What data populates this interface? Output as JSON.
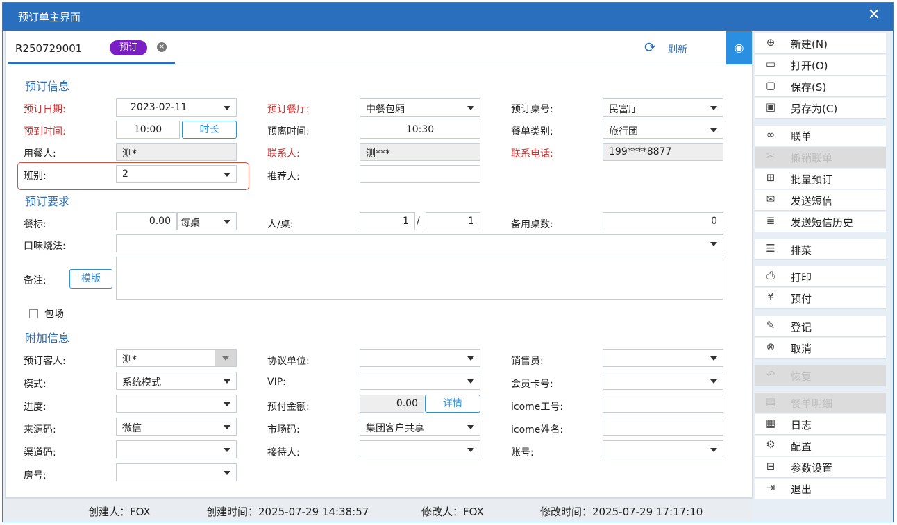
{
  "window": {
    "title": "预订单主界面",
    "close": "✕"
  },
  "tab": {
    "order_no": "R250729001",
    "badge": "预订",
    "close": "×"
  },
  "toolbar": {
    "refresh": "刷新",
    "refresh_icon": "⟳",
    "eye_icon": "◉"
  },
  "sections": {
    "booking_info": "预订信息",
    "booking_req": "预订要求",
    "extra_info": "附加信息"
  },
  "booking": {
    "date_label": "预订日期:",
    "date_value": "2023-02-11",
    "hall_label": "预订餐厅:",
    "hall_value": "中餐包厢",
    "table_label": "预订桌号:",
    "table_value": "民富厅",
    "arrive_label": "预到时间:",
    "arrive_value": "10:00",
    "duration_btn": "时长",
    "leave_label": "预离时间:",
    "leave_value": "10:30",
    "menu_type_label": "餐单类别:",
    "menu_type_value": "旅行团",
    "diner_label": "用餐人:",
    "diner_value": "测*",
    "contact_label": "联系人:",
    "contact_value": "测***",
    "phone_label": "联系电话:",
    "phone_value": "199****8877",
    "shift_label": "班别:",
    "shift_value": "2",
    "referrer_label": "推荐人:",
    "referrer_value": ""
  },
  "requirements": {
    "standard_label": "餐标:",
    "standard_value": "0.00",
    "standard_unit": "每桌",
    "per_table_label": "人/桌:",
    "per_table_a": "1",
    "per_table_sep": "/",
    "per_table_b": "1",
    "spare_label": "备用桌数:",
    "spare_value": "0",
    "taste_label": "口味烧法:",
    "taste_value": "",
    "remark_label": "备注:",
    "template_btn": "模版",
    "private_label": "包场"
  },
  "extra": {
    "guest_label": "预订客人:",
    "guest_value": "测*",
    "agreement_label": "协议单位:",
    "agreement_value": "",
    "sales_label": "销售员:",
    "sales_value": "",
    "mode_label": "模式:",
    "mode_value": "系统模式",
    "vip_label": "VIP:",
    "vip_value": "",
    "member_label": "会员卡号:",
    "member_value": "",
    "progress_label": "进度:",
    "progress_value": "",
    "prepay_label": "预付金额:",
    "prepay_value": "0.00",
    "detail_btn": "详情",
    "icome_no_label": "icome工号:",
    "icome_no_value": "",
    "source_label": "来源码:",
    "source_value": "微信",
    "market_label": "市场码:",
    "market_value": "集团客户共享",
    "icome_name_label": "icome姓名:",
    "icome_name_value": "",
    "channel_label": "渠道码:",
    "channel_value": "",
    "receptionist_label": "接待人:",
    "receptionist_value": "",
    "account_label": "账号:",
    "account_value": "",
    "room_label": "房号:",
    "room_value": ""
  },
  "footer": {
    "creator": "创建人：FOX",
    "created": "创建时间：2025-07-29 14:38:57",
    "modifier": "修改人：FOX",
    "modified": "修改时间：2025-07-29 17:17:10"
  },
  "menu": [
    {
      "label": "新建(N)",
      "icon": "⊕",
      "disabled": false
    },
    {
      "label": "打开(O)",
      "icon": "▭",
      "disabled": false
    },
    {
      "label": "保存(S)",
      "icon": "▢",
      "disabled": false
    },
    {
      "label": "另存为(C)",
      "icon": "▣",
      "disabled": false
    },
    {
      "label": "联单",
      "icon": "∞",
      "disabled": false
    },
    {
      "label": "撤销联单",
      "icon": "✂",
      "disabled": true
    },
    {
      "label": "批量预订",
      "icon": "⊞",
      "disabled": false
    },
    {
      "label": "发送短信",
      "icon": "✉",
      "disabled": false
    },
    {
      "label": "发送短信历史",
      "icon": "≣",
      "disabled": false
    },
    {
      "label": "排菜",
      "icon": "☰",
      "disabled": false
    },
    {
      "label": "打印",
      "icon": "⎙",
      "disabled": false
    },
    {
      "label": "预付",
      "icon": "¥",
      "disabled": false
    },
    {
      "label": "登记",
      "icon": "✎",
      "disabled": false
    },
    {
      "label": "取消",
      "icon": "⊗",
      "disabled": false
    },
    {
      "label": "恢复",
      "icon": "↶",
      "disabled": true
    },
    {
      "label": "餐单明细",
      "icon": "▤",
      "disabled": true
    },
    {
      "label": "日志",
      "icon": "▦",
      "disabled": false
    },
    {
      "label": "配置",
      "icon": "⚙",
      "disabled": false
    },
    {
      "label": "参数设置",
      "icon": "⊟",
      "disabled": false
    },
    {
      "label": "退出",
      "icon": "⇥",
      "disabled": false
    }
  ]
}
